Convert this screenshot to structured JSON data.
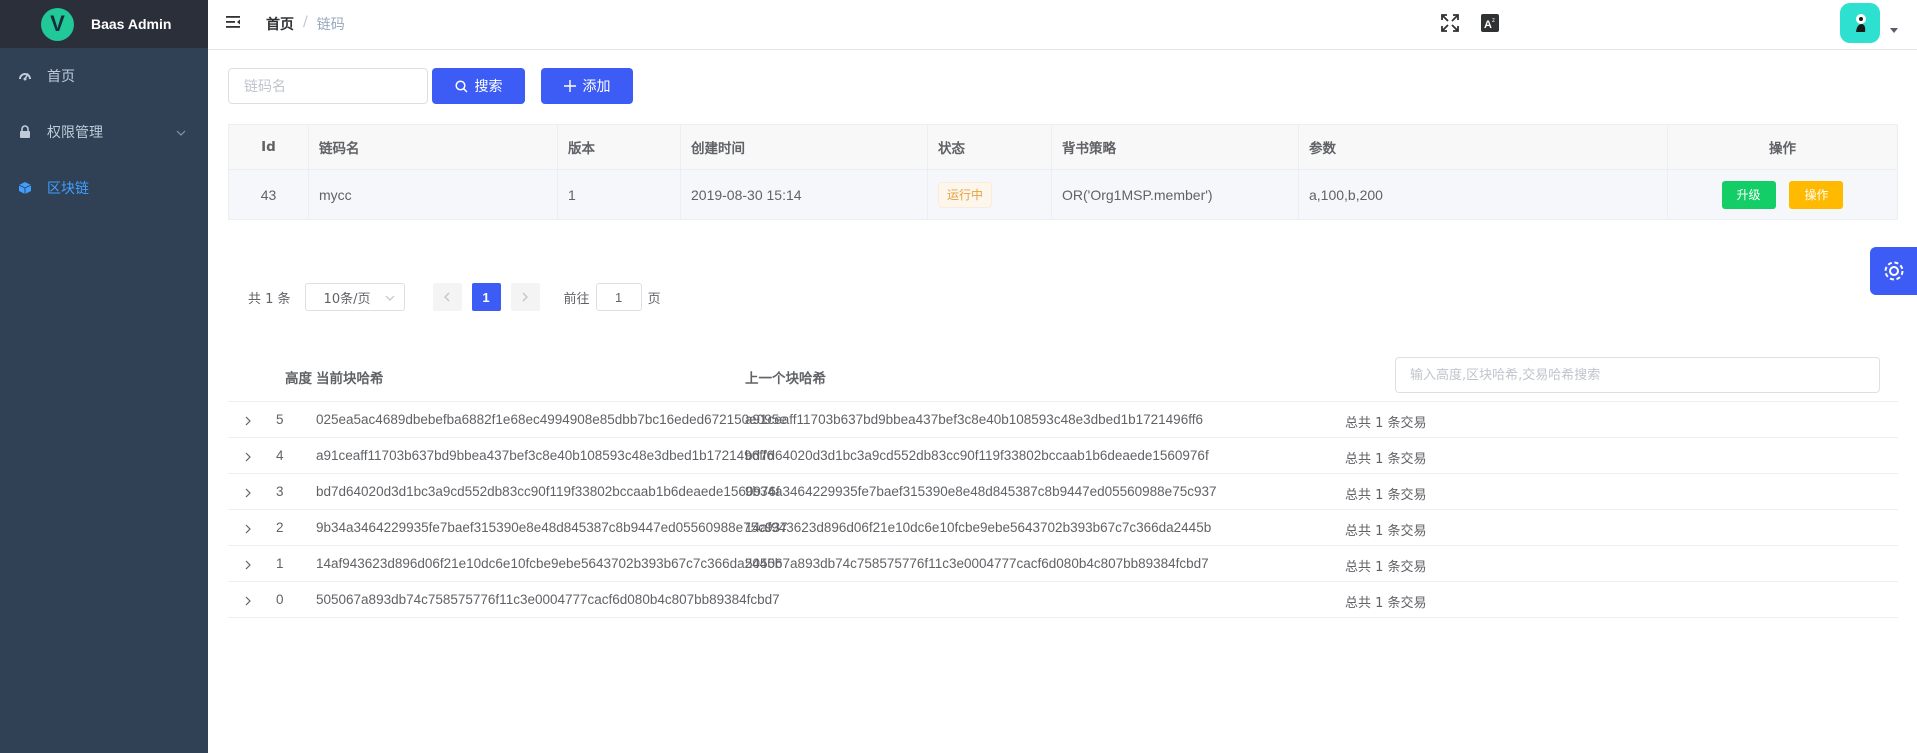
{
  "app": {
    "title": "Baas Admin",
    "logo_letter": "V"
  },
  "sidebar": {
    "items": [
      {
        "label": "首页",
        "icon": "dashboard-icon"
      },
      {
        "label": "权限管理",
        "icon": "lock-icon",
        "has_children": true
      },
      {
        "label": "区块链",
        "icon": "cube-icon",
        "active": true
      }
    ]
  },
  "navbar": {
    "breadcrumb": {
      "home": "首页",
      "separator": "/",
      "current": "链码"
    },
    "icons": [
      "hamburger-icon",
      "fullscreen-icon",
      "font-size-icon",
      "avatar",
      "caret-down-icon"
    ]
  },
  "filter": {
    "name_placeholder": "链码名",
    "search_label": "搜索",
    "add_label": "添加"
  },
  "chaincode_table": {
    "headers": [
      "Id",
      "链码名",
      "版本",
      "创建时间",
      "状态",
      "背书策略",
      "参数",
      "操作"
    ],
    "rows": [
      {
        "id": "43",
        "name": "mycc",
        "version": "1",
        "created": "2019-08-30 15:14",
        "status": "运行中",
        "policy": "OR('Org1MSP.member')",
        "args": "a,100,b,200",
        "upgrade_label": "升级",
        "op_label": "操作"
      }
    ]
  },
  "pagination": {
    "total": "共 1 条",
    "page_size": "10条/页",
    "current_page": "1",
    "goto_prefix": "前往",
    "goto_value": "1",
    "goto_suffix": "页"
  },
  "blocks": {
    "headers": {
      "height": "高度",
      "current_hash": "当前块哈希",
      "prev_hash": "上一个块哈希"
    },
    "search_placeholder": "输入高度,区块哈希,交易哈希搜索",
    "rows": [
      {
        "height": "5",
        "hash": "025ea5ac4689dbebefba6882f1e68ec4994908e85dbb7bc16eded672150e095e",
        "prev": "a91ceaff11703b637bd9bbea437bef3c8e40b108593c48e3dbed1b1721496ff6",
        "tx": "总共 1 条交易"
      },
      {
        "height": "4",
        "hash": "a91ceaff11703b637bd9bbea437bef3c8e40b108593c48e3dbed1b1721496ff6",
        "prev": "bd7d64020d3d1bc3a9cd552db83cc90f119f33802bccaab1b6deaede1560976f",
        "tx": "总共 1 条交易"
      },
      {
        "height": "3",
        "hash": "bd7d64020d3d1bc3a9cd552db83cc90f119f33802bccaab1b6deaede1560976f",
        "prev": "9b34a3464229935fe7baef315390e8e48d845387c8b9447ed05560988e75c937",
        "tx": "总共 1 条交易"
      },
      {
        "height": "2",
        "hash": "9b34a3464229935fe7baef315390e8e48d845387c8b9447ed05560988e75c937",
        "prev": "14af943623d896d06f21e10dc6e10fcbe9ebe5643702b393b67c7c366da2445b",
        "tx": "总共 1 条交易"
      },
      {
        "height": "1",
        "hash": "14af943623d896d06f21e10dc6e10fcbe9ebe5643702b393b67c7c366da2445b",
        "prev": "505067a893db74c758575776f11c3e0004777cacf6d080b4c807bb89384fcbd7",
        "tx": "总共 1 条交易"
      },
      {
        "height": "0",
        "hash": "505067a893db74c758575776f11c3e0004777cacf6d080b4c807bb89384fcbd7",
        "prev": "",
        "tx": "总共 1 条交易"
      }
    ]
  },
  "colors": {
    "sidebar_bg": "#304156",
    "primary": "#3d5cf5",
    "success": "#13ce66",
    "warning": "#ffba00",
    "active_menu": "#409eff"
  }
}
